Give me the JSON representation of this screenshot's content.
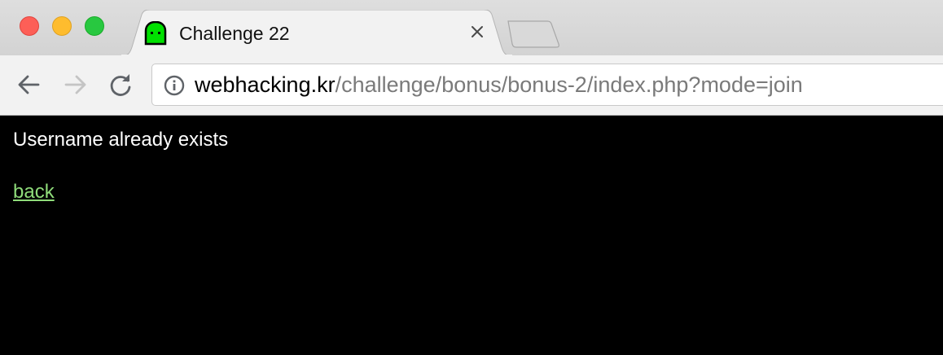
{
  "browser": {
    "tab": {
      "title": "Challenge 22",
      "favicon": "green-ghost-icon"
    },
    "address_bar": {
      "host": "webhacking.kr",
      "path": "/challenge/bonus/bonus-2/index.php?mode=join"
    },
    "icons": {
      "close": "close-icon",
      "back": "back-arrow-icon",
      "forward": "forward-arrow-icon",
      "reload": "reload-icon",
      "info": "info-icon"
    }
  },
  "page": {
    "message": "Username already exists",
    "back_link": "back"
  },
  "colors": {
    "page_background": "#000000",
    "message_text": "#ffffff",
    "link": "#8fdc7a",
    "favicon": "#00e000"
  }
}
